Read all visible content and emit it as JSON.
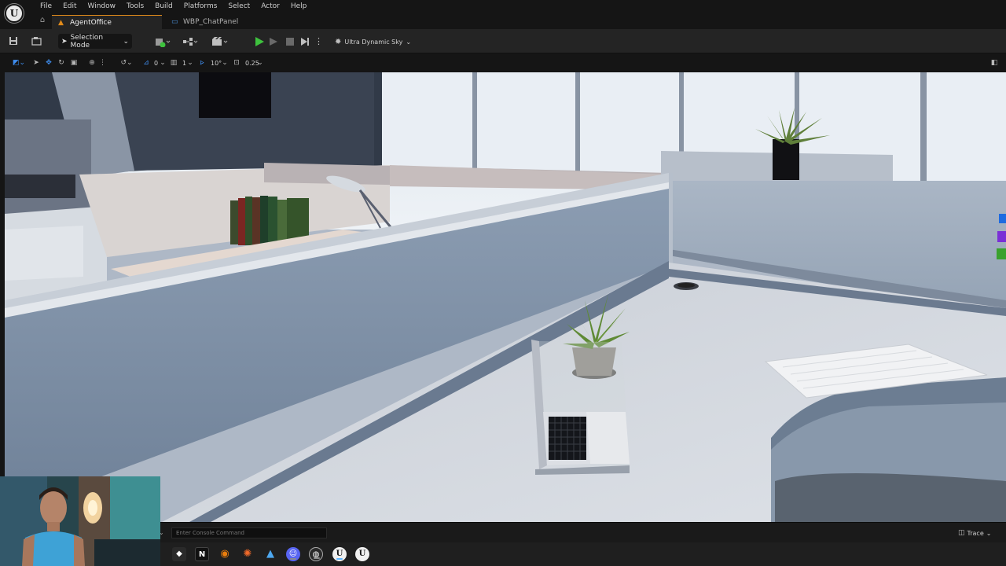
{
  "app": {
    "logo_text": "U",
    "menu": [
      "File",
      "Edit",
      "Window",
      "Tools",
      "Build",
      "Platforms",
      "Select",
      "Actor",
      "Help"
    ]
  },
  "tabs": [
    {
      "label": "AgentOffice",
      "icon": "level-icon",
      "active": true
    },
    {
      "label": "WBP_ChatPanel",
      "icon": "widget-blueprint-icon",
      "active": false
    }
  ],
  "toolbar": {
    "mode_label": "Selection Mode",
    "sky_label": "Ultra Dynamic Sky",
    "icons": [
      "save-icon",
      "content-browser-icon",
      "add-actor-icon",
      "blueprint-icon",
      "cinematics-icon",
      "play-icon",
      "skip-frame-icon",
      "stop-icon",
      "launch-icon",
      "more-options-icon"
    ]
  },
  "viewport_toolbar": {
    "rotation_snap_value": "0",
    "scale_snap_value": "1",
    "angle_snap_value": "10°",
    "camera_speed_value": "0.25"
  },
  "console": {
    "placeholder": "Enter Console Command"
  },
  "status": {
    "trace_label": "Trace"
  },
  "taskbar": {
    "apps": [
      "unity-icon",
      "vectorworks-icon",
      "blender-icon",
      "app-orange-icon",
      "affinity-icon",
      "discord-icon",
      "obs-icon",
      "unreal-engine-icon",
      "unreal-engine-icon-2"
    ]
  },
  "colors": {
    "accent": "#e08a1a",
    "play_green": "#3ec23e",
    "selection_blue": "#3f8ef0",
    "panel_bg": "#242424",
    "menu_bg": "#151515"
  }
}
